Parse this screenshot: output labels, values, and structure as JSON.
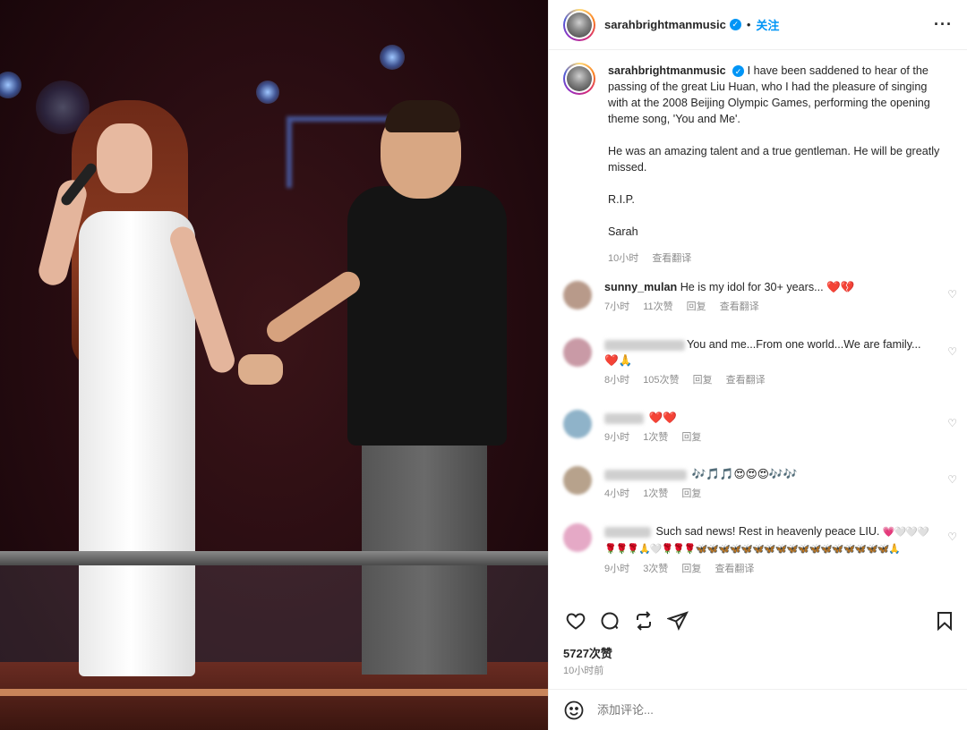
{
  "post": {
    "username": "sarahbrightmanmusic",
    "follow_label": "关注",
    "dot": "•",
    "more_icon": "more-horizontal-icon",
    "caption_paragraphs": [
      "I have been saddened to hear of the passing of the great Liu Huan, who I had the pleasure of singing with at the 2008 Beijing Olympic Games, performing the opening theme song, 'You and Me'.",
      "He was an amazing talent and a true gentleman. He will be greatly missed.",
      "R.I.P.",
      "Sarah"
    ],
    "caption_time": "10小时",
    "translate_label": "查看翻译",
    "like_count": "5727次赞",
    "posted_time": "10小时前",
    "add_comment_placeholder": "添加评论..."
  },
  "comments": [
    {
      "username": "sunny_mulan",
      "text": "He is my idol for 30+ years...",
      "emoji": "❤️💔",
      "time": "7小时",
      "likes": "11次赞",
      "reply": "回复",
      "translate": "查看翻译",
      "avatar_color": "#b89a8a"
    },
    {
      "username": "",
      "text": "You and me...From one world...We are family...",
      "emoji": "❤️🙏",
      "time": "8小时",
      "likes": "105次赞",
      "reply": "回复",
      "translate": "查看翻译",
      "avatar_color": "#c99aa6"
    },
    {
      "username": "",
      "text": "",
      "emoji": "❤️❤️",
      "time": "9小时",
      "likes": "1次赞",
      "reply": "回复",
      "translate": "",
      "avatar_color": "#8fb3c9"
    },
    {
      "username": "",
      "text": "",
      "emoji": "🎶🎵🎵😍😍😍🎶🎶",
      "time": "4小时",
      "likes": "1次赞",
      "reply": "回复",
      "translate": "",
      "avatar_color": "#b7a28c"
    },
    {
      "username": "",
      "text": "Such sad news! Rest in heavenly peace LIU.",
      "emoji": "💗🤍🤍🤍🌹🌹🌹🙏🤍🌹🌹🌹🦋🦋🦋🦋🦋🦋🦋🦋🦋🦋🦋🦋🦋🦋🦋🦋🦋🙏",
      "time": "9小时",
      "likes": "3次赞",
      "reply": "回复",
      "translate": "查看翻译",
      "avatar_color": "#e5a9c6"
    }
  ],
  "colors": {
    "link_blue": "#0095f6",
    "muted": "#8e8e8e",
    "heart_red": "#ed1b3c"
  },
  "icons": [
    "heart-icon",
    "comment-icon",
    "repost-icon",
    "share-icon",
    "bookmark-icon",
    "emoji-icon",
    "verified-icon"
  ]
}
